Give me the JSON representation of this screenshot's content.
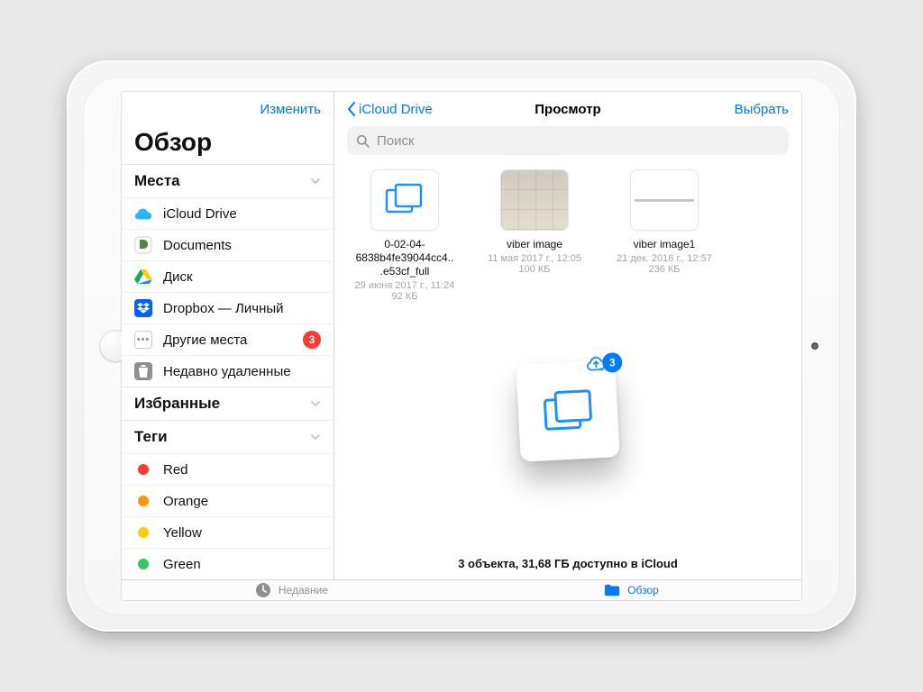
{
  "sidebar": {
    "edit": "Изменить",
    "title": "Обзор",
    "locations_header": "Места",
    "favorites_header": "Избранные",
    "tags_header": "Теги",
    "items": [
      {
        "label": "iCloud Drive"
      },
      {
        "label": "Documents"
      },
      {
        "label": "Диск"
      },
      {
        "label": "Dropbox — Личный"
      },
      {
        "label": "Другие места",
        "badge": "3"
      },
      {
        "label": "Недавно удаленные"
      }
    ],
    "tags": [
      {
        "label": "Red",
        "color": "#ff3b30"
      },
      {
        "label": "Orange",
        "color": "#ff9500"
      },
      {
        "label": "Yellow",
        "color": "#ffcc00"
      },
      {
        "label": "Green",
        "color": "#34c759"
      }
    ]
  },
  "main": {
    "back_label": "iCloud Drive",
    "title": "Просмотр",
    "select": "Выбрать",
    "search_placeholder": "Поиск",
    "files": [
      {
        "name": "0-02-04-6838b4fe39044cc4...e53cf_full",
        "meta": "29 июня 2017 г., 11:24",
        "size": "92 КБ"
      },
      {
        "name": "viber image",
        "meta": "11 мая 2017 г., 12:05",
        "size": "100 КБ"
      },
      {
        "name": "viber image1",
        "meta": "21 дек. 2016 г., 12:57",
        "size": "236 КБ"
      }
    ],
    "status": "3 объекта, 31,68 ГБ доступно в iCloud",
    "upload_badge": "3"
  },
  "tabbar": {
    "recent": "Недавние",
    "browse": "Обзор"
  }
}
